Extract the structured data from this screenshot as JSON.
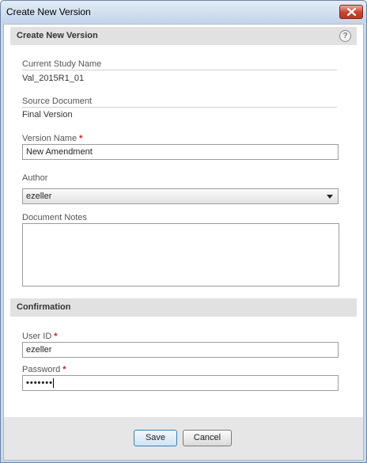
{
  "window": {
    "title": "Create New Version"
  },
  "sections": {
    "main_title": "Create New Version",
    "help_glyph": "?",
    "confirmation_title": "Confirmation"
  },
  "fields": {
    "current_study_label": "Current Study Name",
    "current_study_value": "Val_2015R1_01",
    "source_doc_label": "Source Document",
    "source_doc_value": "Final Version",
    "version_name_label": "Version Name",
    "version_name_value": "New Amendment",
    "author_label": "Author",
    "author_value": "ezeller",
    "notes_label": "Document Notes",
    "notes_value": "",
    "user_id_label": "User ID",
    "user_id_value": "ezeller",
    "password_label": "Password",
    "password_mask": "•••••••",
    "required_marker": "*"
  },
  "buttons": {
    "save": "Save",
    "cancel": "Cancel"
  },
  "icons": {
    "close": "close-icon",
    "help": "help-icon",
    "dropdown": "chevron-down-icon"
  },
  "colors": {
    "required": "#cc1f1f",
    "close_button": "#c8432f",
    "primary_button_border": "#3c7fb1"
  }
}
